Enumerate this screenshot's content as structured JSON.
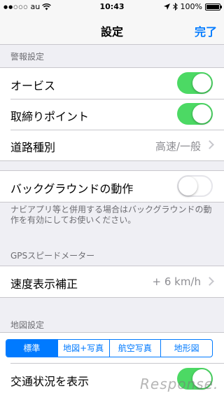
{
  "status_bar": {
    "carrier": "au",
    "time": "10:43",
    "battery": "100%",
    "battery_level": 1.0
  },
  "nav": {
    "title": "設定",
    "done_label": "完了"
  },
  "sections": {
    "alert": {
      "header": "警報設定",
      "rows": [
        {
          "label": "オービス",
          "toggle": true
        },
        {
          "label": "取締りポイント",
          "toggle": true
        },
        {
          "label": "道路種別",
          "value": "高速/一般"
        }
      ]
    },
    "background": {
      "label": "バックグラウンドの動作",
      "toggle": false,
      "note": "ナビアプリ等と併用する場合はバックグラウンドの動作を有効にしてお使いください。"
    },
    "gps": {
      "header": "GPSスピードメーター",
      "row_label": "速度表示補正",
      "row_value": "+ 6 km/h"
    },
    "map": {
      "header": "地図設定",
      "segments": [
        "標準",
        "地図+写真",
        "航空写真",
        "地形図"
      ],
      "selected_segment": "標準",
      "traffic_label": "交通状況を表示",
      "traffic_toggle": true
    }
  },
  "watermark": "Response.",
  "colors": {
    "accent": "#007aff",
    "toggle_on": "#4cd964",
    "background": "#efeff4"
  }
}
